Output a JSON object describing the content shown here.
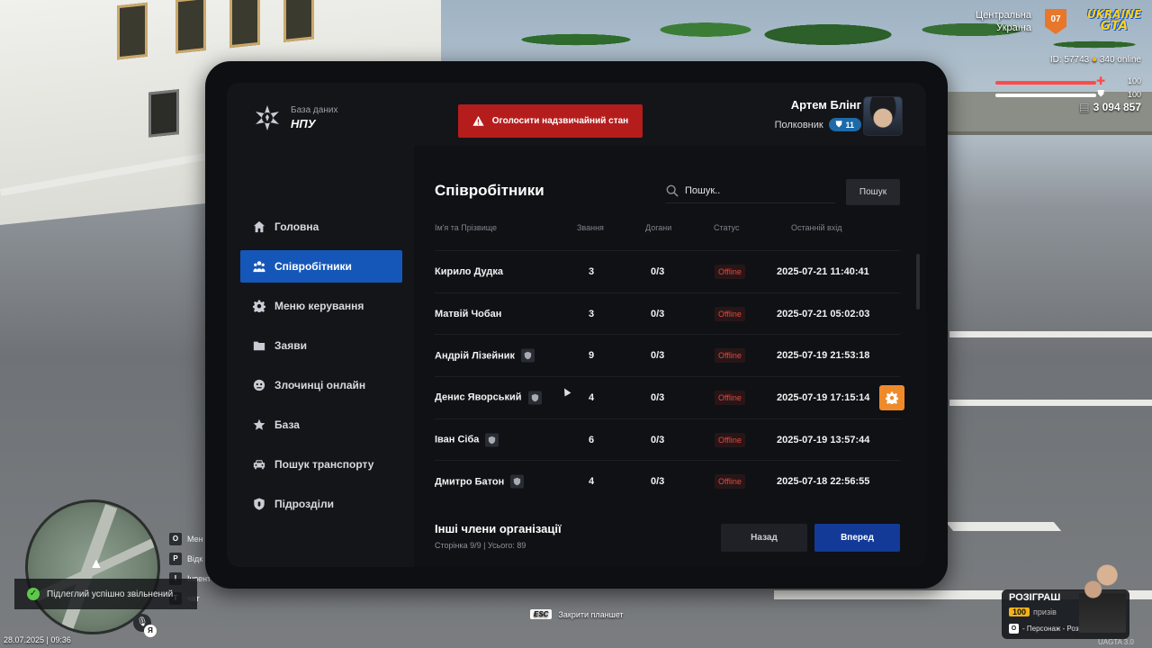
{
  "hud": {
    "city_line1": "Центральна",
    "city_line2": "Україна",
    "server_badge": "07",
    "logo_line1": "UKRAINE",
    "logo_line2": "GTA",
    "id_text": "ID: 57743",
    "online_text": "340 online",
    "health": "100",
    "armor": "100",
    "money": "3 094 857",
    "minimap_keys": [
      {
        "key": "O",
        "label": "Мен"
      },
      {
        "key": "P",
        "label": "Відк"
      },
      {
        "key": "I",
        "label": "Інвент"
      },
      {
        "key": "T",
        "label": "чат"
      }
    ],
    "toast": "Підлеглий успішно звільнений",
    "datetime": "28.07.2025 | 09:36",
    "lang": "Я",
    "esc_key": "ESC",
    "esc_label": "Закрити планшет",
    "raffle_title": "РОЗІГРАШ",
    "raffle_count": "100",
    "raffle_prizes": "призів",
    "raffle_desc": "- Персонаж - Розіграш",
    "version": "UAGTA 3.0"
  },
  "app": {
    "brand_sub": "База даних",
    "brand_name": "НПУ",
    "alarm_label": "Оголосити надзвичайний стан",
    "user_name": "Артем Блінг",
    "user_rank": "Полковник",
    "user_level": "11"
  },
  "menu": [
    {
      "label": "Головна",
      "icon": "home-icon"
    },
    {
      "label": "Співробітники",
      "icon": "people-icon",
      "active": true
    },
    {
      "label": "Меню керування",
      "icon": "gear-icon"
    },
    {
      "label": "Заяви",
      "icon": "folder-icon"
    },
    {
      "label": "Злочинці онлайн",
      "icon": "criminal-icon"
    },
    {
      "label": "База",
      "icon": "star-icon"
    },
    {
      "label": "Пошук транспорту",
      "icon": "car-icon"
    },
    {
      "label": "Підрозділи",
      "icon": "shield-icon"
    }
  ],
  "employees": {
    "title": "Співробітники",
    "search_placeholder": "Пошук..",
    "search_button": "Пошук",
    "columns": [
      "Ім'я та Прізвище",
      "Звання",
      "Догани",
      "Статус",
      "Останній вхід"
    ],
    "rows": [
      {
        "name": "Кирило Дудка",
        "rank": "3",
        "warns": "0/3",
        "status": "Offline",
        "last": "2025-07-21 11:40:41",
        "badge": false
      },
      {
        "name": "Матвій Чобан",
        "rank": "3",
        "warns": "0/3",
        "status": "Offline",
        "last": "2025-07-21 05:02:03",
        "badge": false
      },
      {
        "name": "Андрій Лізейник",
        "rank": "9",
        "warns": "0/3",
        "status": "Offline",
        "last": "2025-07-19 21:53:18",
        "badge": true
      },
      {
        "name": "Денис Яворський",
        "rank": "4",
        "warns": "0/3",
        "status": "Offline",
        "last": "2025-07-19 17:15:14",
        "badge": true,
        "gear": true
      },
      {
        "name": "Іван Сіба",
        "rank": "6",
        "warns": "0/3",
        "status": "Offline",
        "last": "2025-07-19 13:57:44",
        "badge": true
      },
      {
        "name": "Дмитро Батон",
        "rank": "4",
        "warns": "0/3",
        "status": "Offline",
        "last": "2025-07-18 22:56:55",
        "badge": true
      }
    ],
    "footer_title": "Інші члени організації",
    "footer_sub": "Сторінка 9/9 | Усього: 89",
    "back_label": "Назад",
    "next_label": "Вперед"
  },
  "colors": {
    "accent_blue": "#1557b8",
    "alarm_red": "#b51d1d",
    "offline_red": "#e2483d",
    "gear_orange": "#ef8a2b"
  }
}
